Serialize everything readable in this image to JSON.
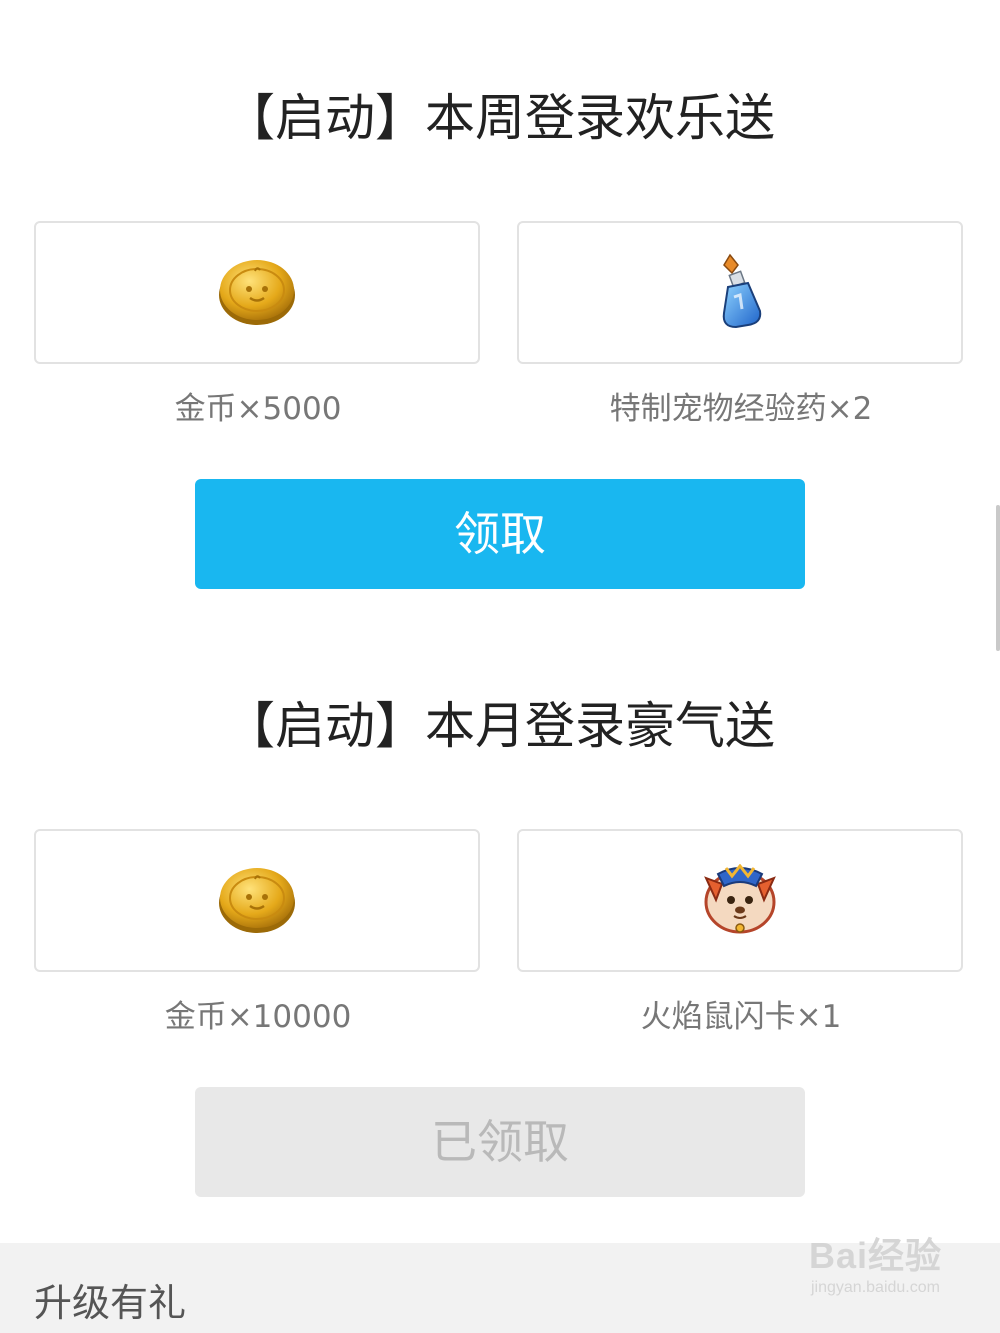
{
  "weekly": {
    "title": "【启动】本周登录欢乐送",
    "rewards": [
      {
        "label": "金币×5000",
        "icon": "gold-coin-icon"
      },
      {
        "label": "特制宠物经验药×2",
        "icon": "exp-potion-icon"
      }
    ],
    "button_label": "领取",
    "button_state": "active"
  },
  "monthly": {
    "title": "【启动】本月登录豪气送",
    "rewards": [
      {
        "label": "金币×10000",
        "icon": "gold-coin-icon"
      },
      {
        "label": "火焰鼠闪卡×1",
        "icon": "flame-mouse-card-icon"
      }
    ],
    "button_label": "已领取",
    "button_state": "claimed"
  },
  "bottom_section": {
    "title": "升级有礼"
  },
  "watermark": {
    "brand": "Bai经验",
    "url": "jingyan.baidu.com"
  },
  "colors": {
    "active_button": "#19b7f0",
    "claimed_button": "#e8e8e8",
    "card_border": "#e2e2e2",
    "bottom_bar": "#f2f2f2"
  }
}
